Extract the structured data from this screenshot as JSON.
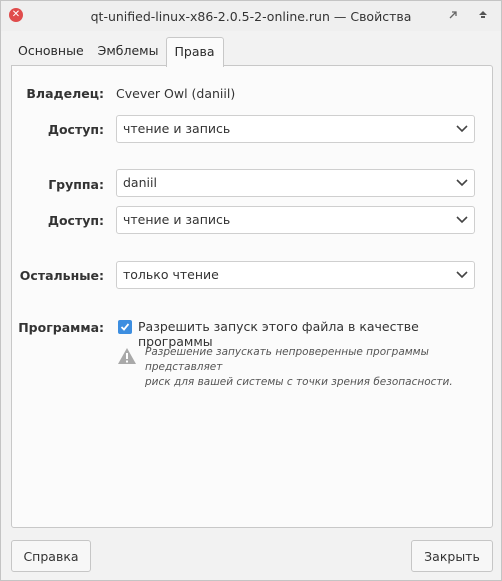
{
  "window": {
    "title": "qt-unified-linux-x86-2.0.5-2-online.run — Свойства"
  },
  "tabs": [
    {
      "label": "Основные",
      "active": false
    },
    {
      "label": "Эмблемы",
      "active": false
    },
    {
      "label": "Права",
      "active": true
    }
  ],
  "permissions": {
    "owner_label": "Владелец:",
    "owner_value": "Cvever Owl (daniil)",
    "owner_access_label": "Доступ:",
    "owner_access_value": "чтение и запись",
    "group_label": "Группа:",
    "group_value": "daniil",
    "group_access_label": "Доступ:",
    "group_access_value": "чтение и запись",
    "others_label": "Остальные:",
    "others_value": "только чтение",
    "program_label": "Программа:",
    "program_checkbox_label": "Разрешить запуск этого файла в качестве программы",
    "program_checkbox_checked": true,
    "warning_line1": "Разрешение запускать непроверенные программы представляет",
    "warning_line2": "риск для вашей системы с точки зрения безопасности."
  },
  "buttons": {
    "help": "Справка",
    "close": "Закрыть"
  },
  "colors": {
    "accent": "#3d8ee0",
    "close_button": "#e04c4c",
    "warning_icon": "#a9a9a9"
  }
}
